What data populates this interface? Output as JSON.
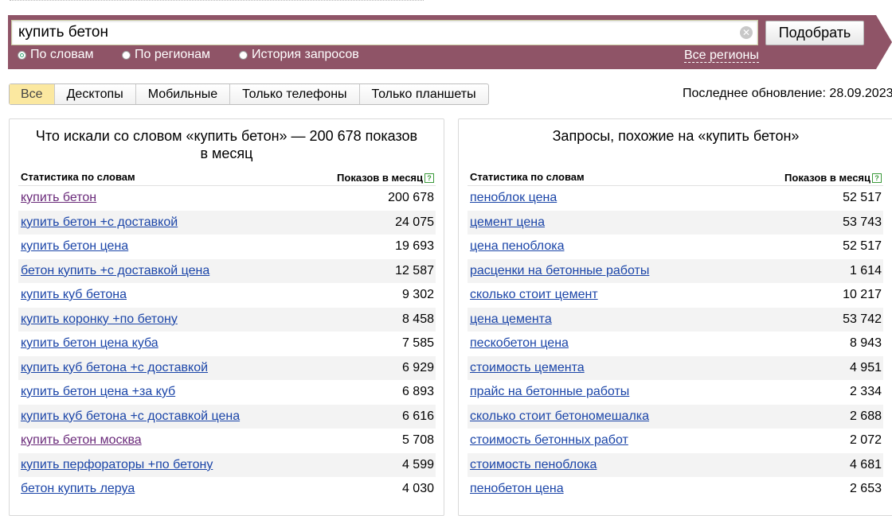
{
  "search": {
    "query": "купить бетон",
    "submit_label": "Подобрать",
    "modes": [
      {
        "label": "По словам",
        "selected": true
      },
      {
        "label": "По регионам",
        "selected": false
      },
      {
        "label": "История запросов",
        "selected": false
      }
    ],
    "regions_link": "Все регионы",
    "clear_icon": "clear-icon"
  },
  "device_tabs": [
    {
      "label": "Все",
      "active": true
    },
    {
      "label": "Десктопы",
      "active": false
    },
    {
      "label": "Мобильные",
      "active": false
    },
    {
      "label": "Только телефоны",
      "active": false
    },
    {
      "label": "Только планшеты",
      "active": false
    }
  ],
  "last_update": "Последнее обновление: 28.09.2023",
  "left_panel": {
    "title": "Что искали со словом «купить бетон» — 200 678 показов в месяц",
    "col_phrase": "Статистика по словам",
    "col_count": "Показов в месяц",
    "rows": [
      {
        "phrase": "купить бетон",
        "count": "200 678"
      },
      {
        "phrase": "купить бетон +с доставкой",
        "count": "24 075"
      },
      {
        "phrase": "купить бетон цена",
        "count": "19 693"
      },
      {
        "phrase": "бетон купить +с доставкой цена",
        "count": "12 587"
      },
      {
        "phrase": "купить куб бетона",
        "count": "9 302"
      },
      {
        "phrase": "купить коронку +по бетону",
        "count": "8 458"
      },
      {
        "phrase": "купить бетон цена куба",
        "count": "7 585"
      },
      {
        "phrase": "купить куб бетона +с доставкой",
        "count": "6 929"
      },
      {
        "phrase": "купить бетон цена +за куб",
        "count": "6 893"
      },
      {
        "phrase": "купить куб бетона +с доставкой цена",
        "count": "6 616"
      },
      {
        "phrase": "купить бетон москва",
        "count": "5 708"
      },
      {
        "phrase": "купить перфораторы +по бетону",
        "count": "4 599"
      },
      {
        "phrase": "бетон купить леруа",
        "count": "4 030"
      }
    ]
  },
  "right_panel": {
    "title": "Запросы, похожие на «купить бетон»",
    "col_phrase": "Статистика по словам",
    "col_count": "Показов в месяц",
    "rows": [
      {
        "phrase": "пеноблок цена",
        "count": "52 517"
      },
      {
        "phrase": "цемент цена",
        "count": "53 743"
      },
      {
        "phrase": "цена пеноблока",
        "count": "52 517"
      },
      {
        "phrase": "расценки на бетонные работы",
        "count": "1 614"
      },
      {
        "phrase": "сколько стоит цемент",
        "count": "10 217"
      },
      {
        "phrase": "цена цемента",
        "count": "53 742"
      },
      {
        "phrase": "пескобетон цена",
        "count": "8 943"
      },
      {
        "phrase": "стоимость цемента",
        "count": "4 951"
      },
      {
        "phrase": "прайс на бетонные работы",
        "count": "2 334"
      },
      {
        "phrase": "сколько стоит бетономешалка",
        "count": "2 688"
      },
      {
        "phrase": "стоимость бетонных работ",
        "count": "2 072"
      },
      {
        "phrase": "стоимость пеноблока",
        "count": "4 681"
      },
      {
        "phrase": "пенобетон цена",
        "count": "2 653"
      }
    ]
  },
  "colors": {
    "banner": "#8f5467",
    "link": "#1b45a8",
    "link_visited": "#6a2a7a",
    "active_tab": "#fbe8a0"
  }
}
